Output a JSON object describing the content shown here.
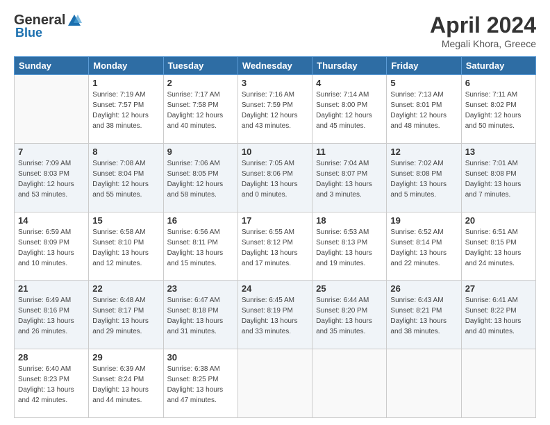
{
  "logo": {
    "general": "General",
    "blue": "Blue"
  },
  "title": "April 2024",
  "location": "Megali Khora, Greece",
  "weekdays": [
    "Sunday",
    "Monday",
    "Tuesday",
    "Wednesday",
    "Thursday",
    "Friday",
    "Saturday"
  ],
  "weeks": [
    [
      {
        "day": "",
        "info": ""
      },
      {
        "day": "1",
        "info": "Sunrise: 7:19 AM\nSunset: 7:57 PM\nDaylight: 12 hours\nand 38 minutes."
      },
      {
        "day": "2",
        "info": "Sunrise: 7:17 AM\nSunset: 7:58 PM\nDaylight: 12 hours\nand 40 minutes."
      },
      {
        "day": "3",
        "info": "Sunrise: 7:16 AM\nSunset: 7:59 PM\nDaylight: 12 hours\nand 43 minutes."
      },
      {
        "day": "4",
        "info": "Sunrise: 7:14 AM\nSunset: 8:00 PM\nDaylight: 12 hours\nand 45 minutes."
      },
      {
        "day": "5",
        "info": "Sunrise: 7:13 AM\nSunset: 8:01 PM\nDaylight: 12 hours\nand 48 minutes."
      },
      {
        "day": "6",
        "info": "Sunrise: 7:11 AM\nSunset: 8:02 PM\nDaylight: 12 hours\nand 50 minutes."
      }
    ],
    [
      {
        "day": "7",
        "info": "Sunrise: 7:09 AM\nSunset: 8:03 PM\nDaylight: 12 hours\nand 53 minutes."
      },
      {
        "day": "8",
        "info": "Sunrise: 7:08 AM\nSunset: 8:04 PM\nDaylight: 12 hours\nand 55 minutes."
      },
      {
        "day": "9",
        "info": "Sunrise: 7:06 AM\nSunset: 8:05 PM\nDaylight: 12 hours\nand 58 minutes."
      },
      {
        "day": "10",
        "info": "Sunrise: 7:05 AM\nSunset: 8:06 PM\nDaylight: 13 hours\nand 0 minutes."
      },
      {
        "day": "11",
        "info": "Sunrise: 7:04 AM\nSunset: 8:07 PM\nDaylight: 13 hours\nand 3 minutes."
      },
      {
        "day": "12",
        "info": "Sunrise: 7:02 AM\nSunset: 8:08 PM\nDaylight: 13 hours\nand 5 minutes."
      },
      {
        "day": "13",
        "info": "Sunrise: 7:01 AM\nSunset: 8:08 PM\nDaylight: 13 hours\nand 7 minutes."
      }
    ],
    [
      {
        "day": "14",
        "info": "Sunrise: 6:59 AM\nSunset: 8:09 PM\nDaylight: 13 hours\nand 10 minutes."
      },
      {
        "day": "15",
        "info": "Sunrise: 6:58 AM\nSunset: 8:10 PM\nDaylight: 13 hours\nand 12 minutes."
      },
      {
        "day": "16",
        "info": "Sunrise: 6:56 AM\nSunset: 8:11 PM\nDaylight: 13 hours\nand 15 minutes."
      },
      {
        "day": "17",
        "info": "Sunrise: 6:55 AM\nSunset: 8:12 PM\nDaylight: 13 hours\nand 17 minutes."
      },
      {
        "day": "18",
        "info": "Sunrise: 6:53 AM\nSunset: 8:13 PM\nDaylight: 13 hours\nand 19 minutes."
      },
      {
        "day": "19",
        "info": "Sunrise: 6:52 AM\nSunset: 8:14 PM\nDaylight: 13 hours\nand 22 minutes."
      },
      {
        "day": "20",
        "info": "Sunrise: 6:51 AM\nSunset: 8:15 PM\nDaylight: 13 hours\nand 24 minutes."
      }
    ],
    [
      {
        "day": "21",
        "info": "Sunrise: 6:49 AM\nSunset: 8:16 PM\nDaylight: 13 hours\nand 26 minutes."
      },
      {
        "day": "22",
        "info": "Sunrise: 6:48 AM\nSunset: 8:17 PM\nDaylight: 13 hours\nand 29 minutes."
      },
      {
        "day": "23",
        "info": "Sunrise: 6:47 AM\nSunset: 8:18 PM\nDaylight: 13 hours\nand 31 minutes."
      },
      {
        "day": "24",
        "info": "Sunrise: 6:45 AM\nSunset: 8:19 PM\nDaylight: 13 hours\nand 33 minutes."
      },
      {
        "day": "25",
        "info": "Sunrise: 6:44 AM\nSunset: 8:20 PM\nDaylight: 13 hours\nand 35 minutes."
      },
      {
        "day": "26",
        "info": "Sunrise: 6:43 AM\nSunset: 8:21 PM\nDaylight: 13 hours\nand 38 minutes."
      },
      {
        "day": "27",
        "info": "Sunrise: 6:41 AM\nSunset: 8:22 PM\nDaylight: 13 hours\nand 40 minutes."
      }
    ],
    [
      {
        "day": "28",
        "info": "Sunrise: 6:40 AM\nSunset: 8:23 PM\nDaylight: 13 hours\nand 42 minutes."
      },
      {
        "day": "29",
        "info": "Sunrise: 6:39 AM\nSunset: 8:24 PM\nDaylight: 13 hours\nand 44 minutes."
      },
      {
        "day": "30",
        "info": "Sunrise: 6:38 AM\nSunset: 8:25 PM\nDaylight: 13 hours\nand 47 minutes."
      },
      {
        "day": "",
        "info": ""
      },
      {
        "day": "",
        "info": ""
      },
      {
        "day": "",
        "info": ""
      },
      {
        "day": "",
        "info": ""
      }
    ]
  ]
}
